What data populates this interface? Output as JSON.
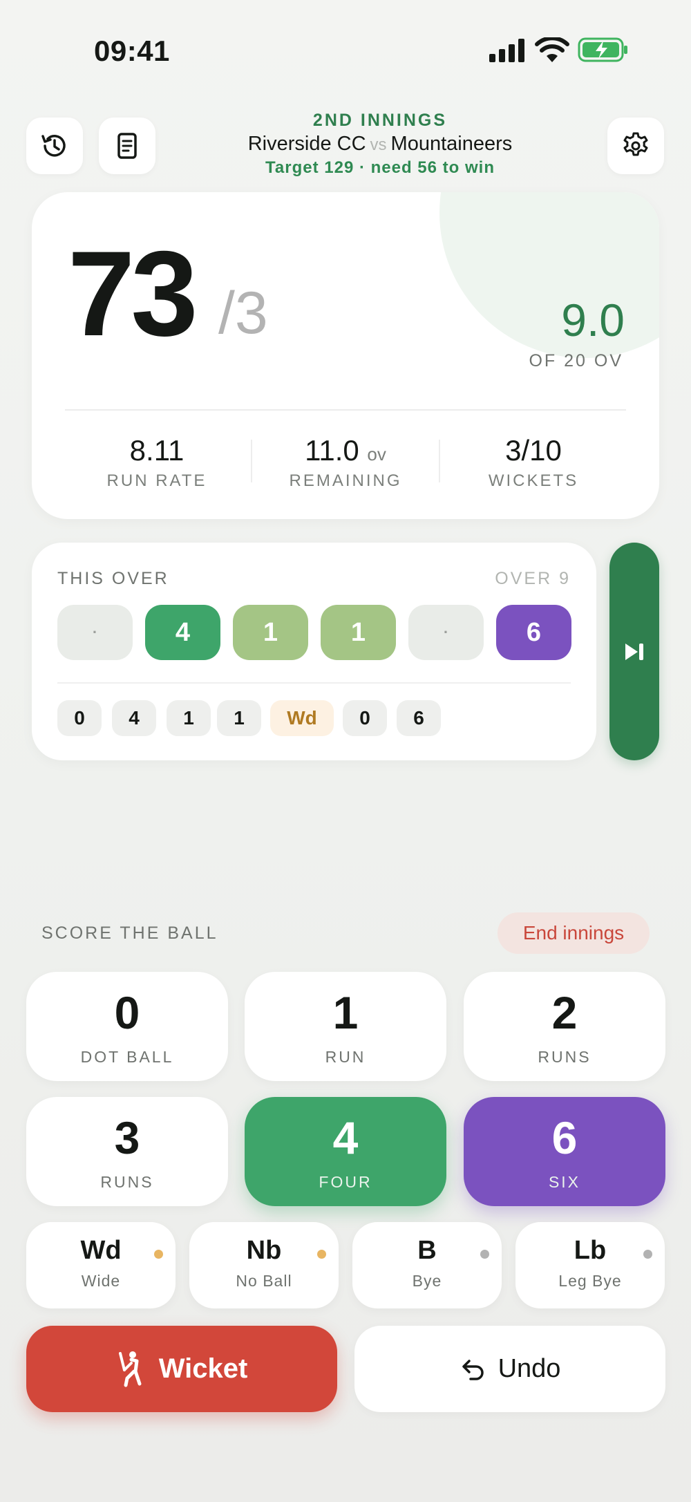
{
  "status_bar": {
    "time": "09:41"
  },
  "header": {
    "innings": "2ND INNINGS",
    "team_batting": "Riverside CC",
    "vs": "vs",
    "team_bowling": "Mountaineers",
    "target_line": "Target 129 · need 56 to win"
  },
  "score": {
    "runs": "73",
    "wickets": "/3",
    "overs": "9.0",
    "overs_of": "OF 20 OV"
  },
  "stats": [
    {
      "value": "8.11",
      "unit": "",
      "label": "RUN RATE"
    },
    {
      "value": "11.0",
      "unit": "OV",
      "label": "REMAINING"
    },
    {
      "value": "3/10",
      "unit": "",
      "label": "WICKETS"
    }
  ],
  "this_over": {
    "title": "THIS OVER",
    "over_label": "OVER 9",
    "balls": [
      "·",
      "4",
      "1",
      "1",
      "·",
      "6"
    ],
    "log": [
      "0",
      "4",
      "1",
      "1",
      "Wd",
      "0",
      "6"
    ]
  },
  "scoring": {
    "title": "SCORE THE BALL",
    "end_innings": "End innings",
    "runs": [
      {
        "num": "0",
        "label": "DOT BALL"
      },
      {
        "num": "1",
        "label": "RUN"
      },
      {
        "num": "2",
        "label": "RUNS"
      },
      {
        "num": "3",
        "label": "RUNS"
      },
      {
        "num": "4",
        "label": "FOUR"
      },
      {
        "num": "6",
        "label": "SIX"
      }
    ],
    "extras": [
      {
        "code": "Wd",
        "name": "Wide",
        "marker_color": "#e8b562"
      },
      {
        "code": "Nb",
        "name": "No Ball",
        "marker_color": "#e8b562"
      },
      {
        "code": "B",
        "name": "Bye",
        "marker_color": "#b2b2b2"
      },
      {
        "code": "Lb",
        "name": "Leg Bye",
        "marker_color": "#b2b2b2"
      }
    ],
    "wicket": "Wicket",
    "undo": "Undo"
  },
  "colors": {
    "accent_green": "#2f7f4e",
    "four_green": "#3ea56a",
    "single_green": "#a4c585",
    "six_purple": "#7b52bf",
    "wicket_red": "#d2473a",
    "extra_amber": "#e8b562"
  },
  "icons": {
    "history": "history-icon",
    "scorecard": "scorecard-icon",
    "settings": "gear-icon",
    "next_over": "skip-forward-icon",
    "wicket": "batsman-out-icon",
    "undo": "undo-arrow-icon"
  }
}
